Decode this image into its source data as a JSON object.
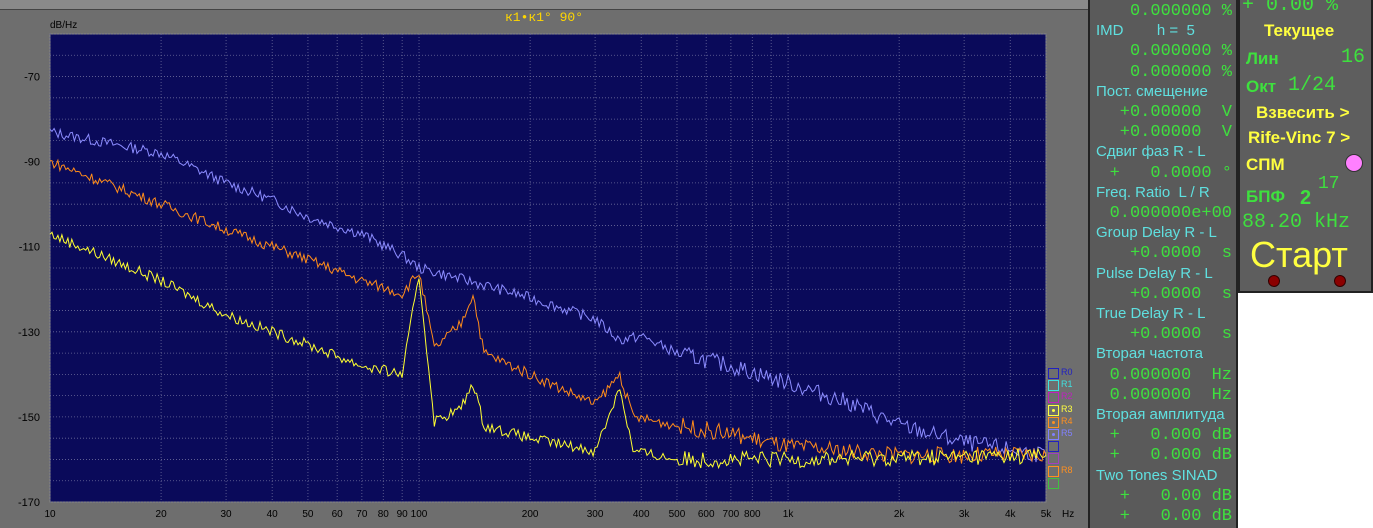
{
  "title": "к1•к1° 90°",
  "left_panel": [
    {
      "t": "val",
      "v": "0.000000 %"
    },
    {
      "t": "lab",
      "v": "IMD        h =  5"
    },
    {
      "t": "val",
      "v": "0.000000 %"
    },
    {
      "t": "val",
      "v": "0.000000 %"
    },
    {
      "t": "lab",
      "v": "Пост. смещение"
    },
    {
      "t": "val",
      "v": "+0.00000  V"
    },
    {
      "t": "val",
      "v": "+0.00000  V"
    },
    {
      "t": "lab",
      "v": "Сдвиг фаз R - L"
    },
    {
      "t": "val",
      "v": "+   0.0000 °"
    },
    {
      "t": "lab",
      "v": "Freq. Ratio  L / R"
    },
    {
      "t": "val",
      "v": "0.000000e+00"
    },
    {
      "t": "lab",
      "v": "Group Delay R - L"
    },
    {
      "t": "val",
      "v": "+0.0000  s"
    },
    {
      "t": "lab",
      "v": "Pulse Delay R - L"
    },
    {
      "t": "val",
      "v": "+0.0000  s"
    },
    {
      "t": "lab",
      "v": "True Delay R - L"
    },
    {
      "t": "val",
      "v": "+0.0000  s"
    },
    {
      "t": "lab",
      "v": "Вторая частота"
    },
    {
      "t": "val",
      "v": "0.000000  Hz"
    },
    {
      "t": "val",
      "v": "0.000000  Hz"
    },
    {
      "t": "lab",
      "v": "Вторая амплитуда"
    },
    {
      "t": "val",
      "v": "+   0.000 dB"
    },
    {
      "t": "val",
      "v": "+   0.000 dB"
    },
    {
      "t": "lab",
      "v": "Two Tones SINAD"
    },
    {
      "t": "val",
      "v": "+   0.00 dB"
    },
    {
      "t": "val",
      "v": "+   0.00 dB"
    }
  ],
  "right_panel": {
    "top_value": "+ 0.00 %",
    "mode": "Текущее",
    "lin_label": "Лин",
    "lin_value": "16",
    "oct_label": "Окт",
    "oct_value": "1/24",
    "weight_button": "Взвесить >",
    "weight_filter": "Rife-Vinc 7 >",
    "psd_label": "СПМ",
    "fft_label": "БПФ",
    "fft_base": "2",
    "fft_exp": "17",
    "sample_rate": "88.20 kHz",
    "start_button": "Старт"
  },
  "legend": [
    {
      "name": "R0",
      "color": "#2020c0",
      "checked": false
    },
    {
      "name": "R1",
      "color": "#40e0e0",
      "checked": false
    },
    {
      "name": "R2",
      "color": "#c020c0",
      "checked": false
    },
    {
      "name": "R3",
      "color": "#ffff40",
      "checked": true
    },
    {
      "name": "R4",
      "color": "#ff9020",
      "checked": true
    },
    {
      "name": "R5",
      "color": "#8080ff",
      "checked": true
    },
    {
      "name": "",
      "color": "#2020c0",
      "checked": false
    },
    {
      "name": "",
      "color": "#a040c0",
      "checked": false
    },
    {
      "name": "R8",
      "color": "#ff9020",
      "checked": false
    },
    {
      "name": "",
      "color": "#40c040",
      "checked": false
    }
  ],
  "chart_data": {
    "type": "line",
    "ylabel": "dB/Hz",
    "xunit": "Hz",
    "xscale": "log",
    "xlim": [
      10,
      5000
    ],
    "ylim": [
      -170,
      -60
    ],
    "yticks": [
      -70,
      -90,
      -110,
      -130,
      -150,
      -170
    ],
    "xticks": [
      "10",
      "20",
      "30",
      "40",
      "50",
      "60",
      "70",
      "80",
      "90",
      "100",
      "200",
      "300",
      "400",
      "500",
      "600",
      "700",
      "800",
      "1k",
      "2k",
      "3k",
      "4k",
      "5k"
    ],
    "xtick_values": [
      10,
      20,
      30,
      40,
      50,
      60,
      70,
      80,
      90,
      100,
      200,
      300,
      400,
      500,
      600,
      700,
      800,
      1000,
      2000,
      3000,
      4000,
      5000
    ],
    "grid": true,
    "series": [
      {
        "name": "R5",
        "color": "#8c8cff",
        "x": [
          10,
          15,
          20,
          30,
          40,
          50,
          70,
          90,
          100,
          150,
          200,
          300,
          350,
          400,
          500,
          700,
          1000,
          1500,
          2000,
          3000,
          5000
        ],
        "y": [
          -83,
          -86,
          -88,
          -95,
          -99,
          -103,
          -107,
          -112,
          -115,
          -119,
          -122,
          -127,
          -132,
          -131,
          -135,
          -138,
          -142,
          -147,
          -152,
          -156,
          -159
        ]
      },
      {
        "name": "R4",
        "color": "#ff8c1a",
        "x": [
          10,
          20,
          30,
          50,
          70,
          90,
          100,
          110,
          130,
          140,
          150,
          200,
          300,
          350,
          380,
          500,
          700,
          1000,
          2000,
          5000
        ],
        "y": [
          -90,
          -100,
          -106,
          -113,
          -118,
          -121,
          -116,
          -134,
          -128,
          -121,
          -135,
          -140,
          -147,
          -140,
          -150,
          -152,
          -154,
          -157,
          -159,
          -159
        ]
      },
      {
        "name": "R3",
        "color": "#ffff30",
        "x": [
          10,
          20,
          30,
          50,
          70,
          90,
          100,
          110,
          130,
          140,
          150,
          200,
          300,
          350,
          380,
          500,
          1000,
          5000
        ],
        "y": [
          -107,
          -118,
          -126,
          -133,
          -138,
          -140,
          -117,
          -151,
          -148,
          -142,
          -152,
          -155,
          -158,
          -143,
          -158,
          -160,
          -160,
          -159
        ]
      }
    ]
  }
}
